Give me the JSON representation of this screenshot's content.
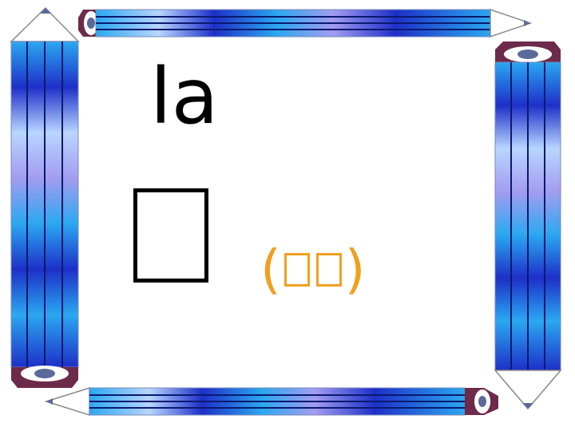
{
  "slide": {
    "pinyin": "la",
    "word_open": "(",
    "word_close": ")"
  },
  "colors": {
    "pencil_dark": "#1e2fc8",
    "pencil_mid": "#2aa8f0",
    "pencil_light": "#b8d6ff",
    "pencil_lavender": "#a39cf0",
    "tip_wood": "#ffffff",
    "tip_lead": "#5a6a9a",
    "end_cap": "#6e2a4a",
    "word_accent": "#f0a020",
    "text": "#000000"
  }
}
